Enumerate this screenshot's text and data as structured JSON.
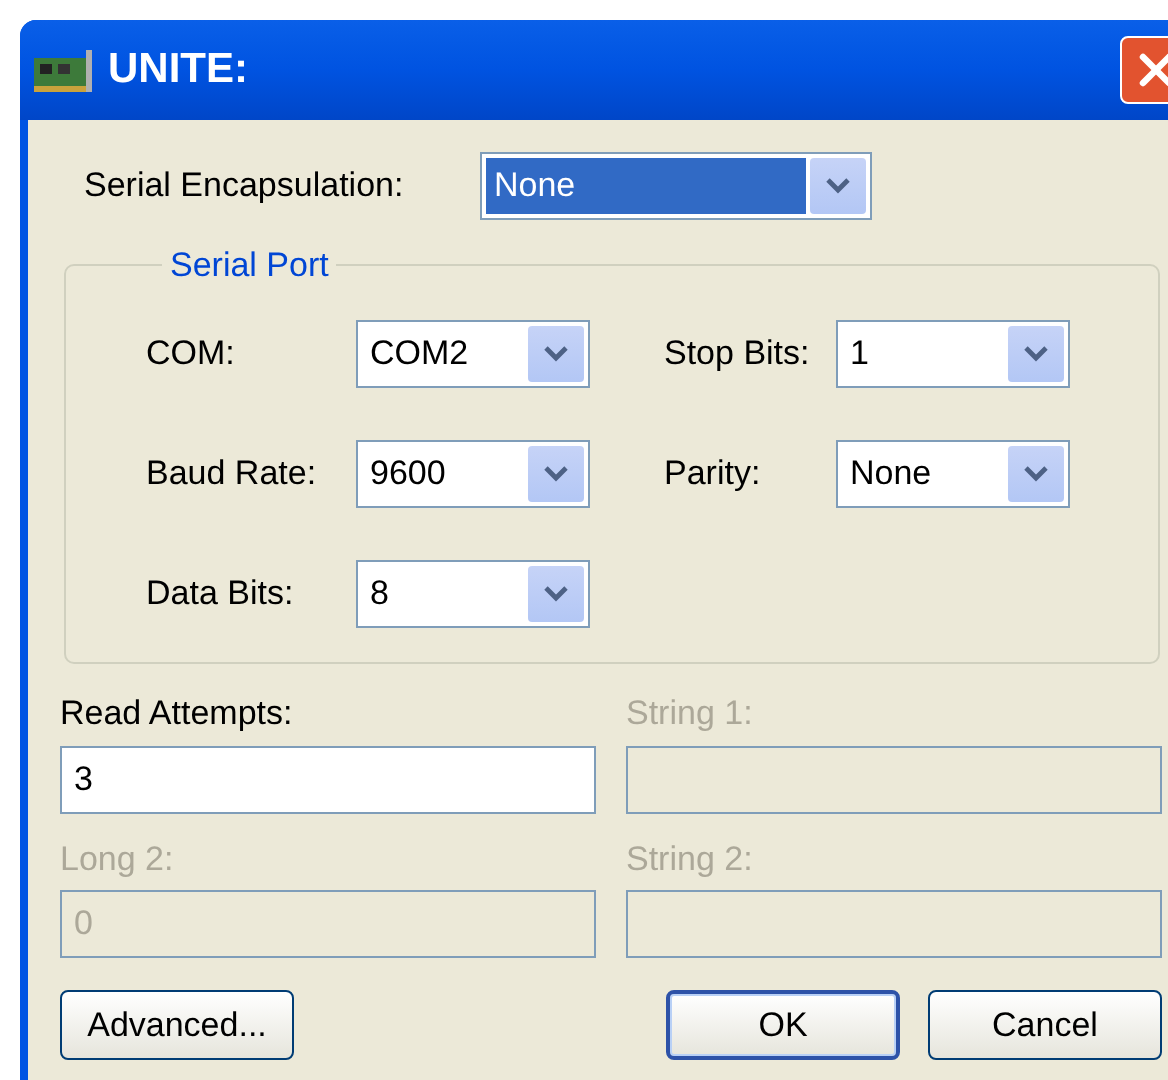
{
  "window": {
    "title": "UNITE:"
  },
  "encapsulation": {
    "label": "Serial Encapsulation:",
    "value": "None",
    "focused": true
  },
  "serial_port": {
    "title": "Serial Port",
    "left_fields": [
      {
        "label": "COM:",
        "value": "COM2"
      },
      {
        "label": "Baud Rate:",
        "value": "9600"
      },
      {
        "label": "Data Bits:",
        "value": "8"
      }
    ],
    "right_fields": [
      {
        "label": "Stop Bits:",
        "value": "1"
      },
      {
        "label": "Parity:",
        "value": "None"
      }
    ]
  },
  "text_fields": [
    {
      "label": "Read Attempts:",
      "value": "3",
      "disabled": false
    },
    {
      "label": "String 1:",
      "disabled": true
    },
    {
      "label": "Long 2:",
      "value": "0",
      "disabled": true
    },
    {
      "label": "String 2:",
      "disabled": true
    }
  ],
  "left_buttons": [
    {
      "label": "Advanced...",
      "default": false
    }
  ],
  "buttons": [
    {
      "label": "OK",
      "default": true
    },
    {
      "label": "Cancel",
      "default": false
    }
  ]
}
